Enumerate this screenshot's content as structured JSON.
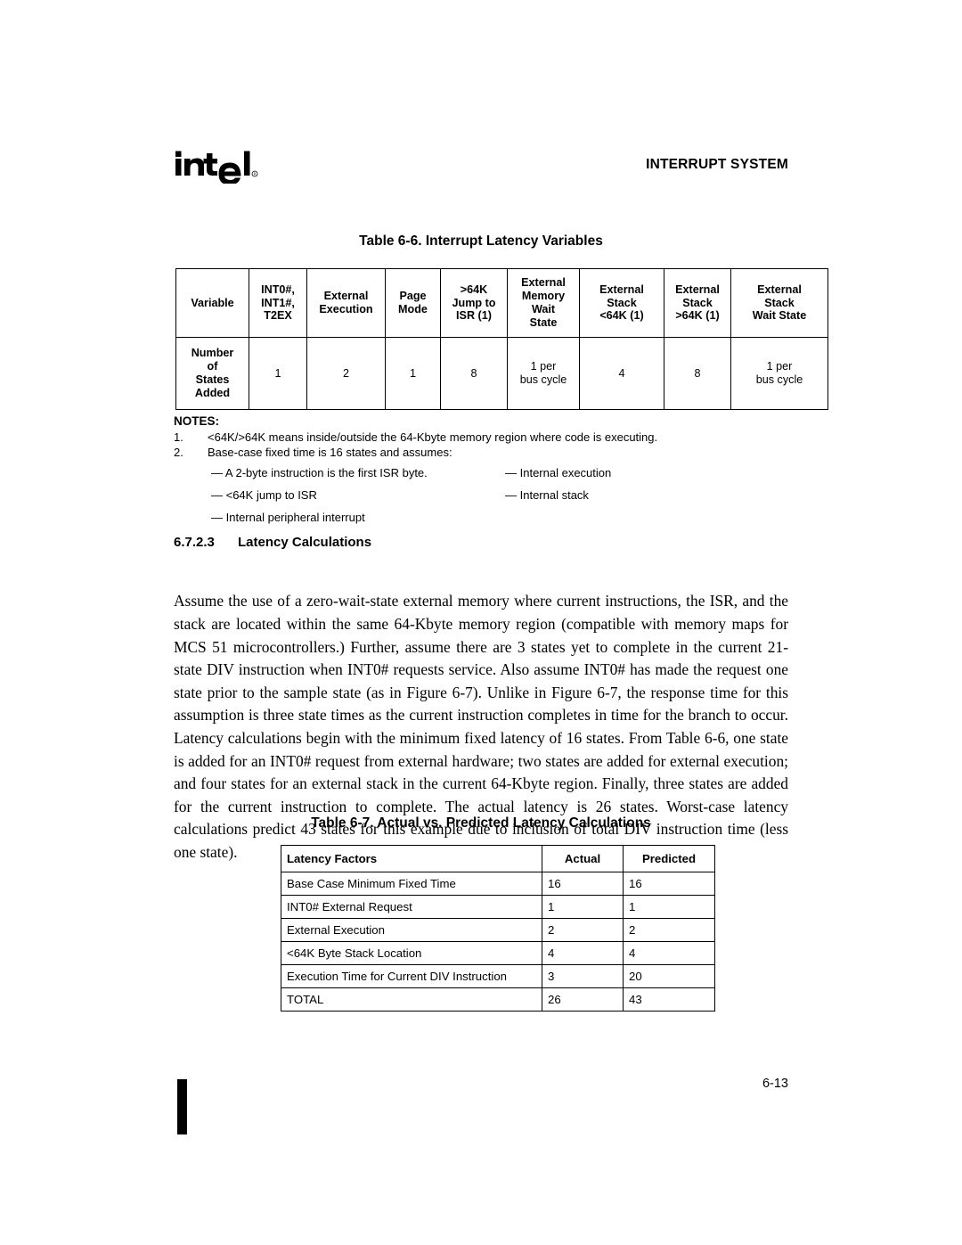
{
  "header": {
    "logo_text": "intel",
    "logo_mark": "registered-trademark",
    "title": "INTERRUPT SYSTEM"
  },
  "table_66": {
    "caption": "Table 6-6.  Interrupt Latency Variables",
    "columns": [
      "Variable",
      "INT0#,\nINT1#,\nT2EX",
      "External\nExecution",
      "Page\nMode",
      ">64K\nJump to\nISR (1)",
      "External\nMemory\nWait\nState",
      "External\nStack\n<64K (1)",
      "External\nStack\n>64K (1)",
      "External\nStack\nWait State"
    ],
    "header_cells": {
      "c0": [
        "Variable"
      ],
      "c1": [
        "INT0#,",
        "INT1#,",
        "T2EX"
      ],
      "c2": [
        "External",
        "Execution"
      ],
      "c3": [
        "Page",
        "Mode"
      ],
      "c4": [
        ">64K",
        "Jump to",
        "ISR (1)"
      ],
      "c5": [
        "External",
        "Memory",
        "Wait",
        "State"
      ],
      "c6": [
        "External",
        "Stack",
        "<64K (1)"
      ],
      "c7": [
        "External",
        "Stack",
        ">64K (1)"
      ],
      "c8": [
        "External",
        "Stack",
        "Wait State"
      ]
    },
    "row_label": [
      "Number",
      "of",
      "States",
      "Added"
    ],
    "values": [
      "1",
      "2",
      "1",
      "8",
      "1 per\nbus cycle",
      "4",
      "8",
      "1 per\nbus cycle"
    ],
    "value_cells": {
      "v0": [
        "1"
      ],
      "v1": [
        "2"
      ],
      "v2": [
        "1"
      ],
      "v3": [
        "8"
      ],
      "v4": [
        "1 per",
        "bus cycle"
      ],
      "v5": [
        "4"
      ],
      "v6": [
        "8"
      ],
      "v7": [
        "1 per",
        "bus cycle"
      ]
    }
  },
  "notes": {
    "title": "NOTES:",
    "items": [
      {
        "num": "1.",
        "text": "<64K/>64K means inside/outside the 64-Kbyte memory region where code is executing."
      },
      {
        "num": "2.",
        "text": "Base-case fixed time is 16 states and assumes:"
      }
    ],
    "assumptions": [
      {
        "left": "— A 2-byte instruction is the first ISR byte.",
        "right": "— Internal execution"
      },
      {
        "left": "— <64K jump to ISR",
        "right": "— Internal stack"
      },
      {
        "left": "— Internal peripheral interrupt",
        "right": ""
      }
    ]
  },
  "section": {
    "number": "6.7.2.3",
    "title": "Latency Calculations",
    "body": "Assume the use of a zero-wait-state external memory where current instructions, the ISR, and the stack are located within the same 64-Kbyte memory region (compatible with memory maps for MCS 51 microcontrollers.) Further, assume there are 3 states yet to complete in the current 21-state DIV instruction when INT0# requests service. Also assume INT0# has made the request one state prior to the sample state (as in Figure 6-7). Unlike in Figure 6-7, the response time for this assumption is three state times as the current instruction completes in time for the branch to occur. Latency calculations begin with the minimum fixed latency of 16 states. From Table 6-6, one state is added for an INT0# request from external hardware; two states are added for external execution; and four states for an external stack in the current 64-Kbyte region. Finally, three states are added for the current instruction to complete. The actual latency is 26 states. Worst-case latency calculations predict 43 states for this example due to inclusion of total DIV instruction time (less one state)."
  },
  "table_67": {
    "caption": "Table 6-7.  Actual vs. Predicted Latency Calculations",
    "columns": [
      "Latency Factors",
      "Actual",
      "Predicted"
    ],
    "rows": [
      {
        "factor": "Base Case Minimum Fixed Time",
        "actual": "16",
        "predicted": "16"
      },
      {
        "factor": "INT0# External Request",
        "actual": "1",
        "predicted": "1"
      },
      {
        "factor": "External Execution",
        "actual": "2",
        "predicted": "2"
      },
      {
        "factor": "<64K Byte Stack Location",
        "actual": "4",
        "predicted": "4"
      },
      {
        "factor": "Execution Time for Current DIV Instruction",
        "actual": "3",
        "predicted": "20"
      },
      {
        "factor": "TOTAL",
        "actual": "26",
        "predicted": "43"
      }
    ]
  },
  "footer": {
    "page_number": "6-13",
    "change_bar": "change-bar-mark"
  }
}
